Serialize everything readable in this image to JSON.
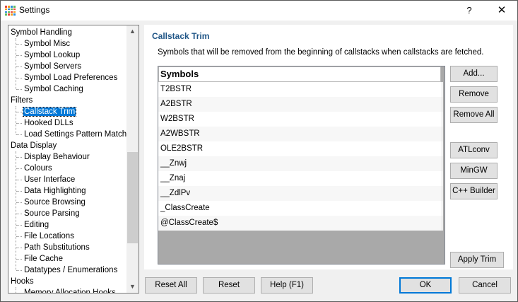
{
  "window": {
    "title": "Settings",
    "help_label": "?",
    "close_label": "✕"
  },
  "tree": {
    "items": [
      {
        "label": "Symbol Handling",
        "level": 0
      },
      {
        "label": "Symbol Misc",
        "level": 1
      },
      {
        "label": "Symbol Lookup",
        "level": 1
      },
      {
        "label": "Symbol Servers",
        "level": 1
      },
      {
        "label": "Symbol Load Preferences",
        "level": 1
      },
      {
        "label": "Symbol Caching",
        "level": 1
      },
      {
        "label": "Filters",
        "level": 0
      },
      {
        "label": "Callstack Trim",
        "level": 1,
        "selected": true
      },
      {
        "label": "Hooked DLLs",
        "level": 1
      },
      {
        "label": "Load Settings Pattern Match",
        "level": 1
      },
      {
        "label": "Data Display",
        "level": 0
      },
      {
        "label": "Display Behaviour",
        "level": 1
      },
      {
        "label": "Colours",
        "level": 1
      },
      {
        "label": "User Interface",
        "level": 1
      },
      {
        "label": "Data Highlighting",
        "level": 1
      },
      {
        "label": "Source Browsing",
        "level": 1
      },
      {
        "label": "Source Parsing",
        "level": 1
      },
      {
        "label": "Editing",
        "level": 1
      },
      {
        "label": "File Locations",
        "level": 1
      },
      {
        "label": "Path Substitutions",
        "level": 1
      },
      {
        "label": "File Cache",
        "level": 1
      },
      {
        "label": "Datatypes / Enumerations",
        "level": 1
      },
      {
        "label": "Hooks",
        "level": 0
      },
      {
        "label": "Memory Allocation Hooks",
        "level": 1
      }
    ],
    "scroll_up_icon": "▲",
    "scroll_down_icon": "▼"
  },
  "panel": {
    "title": "Callstack Trim",
    "description": "Symbols that will be removed from the beginning of callstacks when callstacks are fetched.",
    "list_header": "Symbols",
    "symbols": [
      "T2BSTR",
      "A2BSTR",
      "W2BSTR",
      "A2WBSTR",
      "OLE2BSTR",
      "__Znwj",
      "__Znaj",
      "__ZdlPv",
      "_ClassCreate",
      "@ClassCreate$"
    ],
    "buttons": {
      "add": "Add...",
      "remove": "Remove",
      "remove_all": "Remove All",
      "atlconv": "ATLconv",
      "mingw": "MinGW",
      "cpp_builder": "C++ Builder",
      "apply_trim": "Apply Trim"
    }
  },
  "footer": {
    "reset_all": "Reset All",
    "reset": "Reset",
    "help": "Help (F1)",
    "ok": "OK",
    "cancel": "Cancel"
  },
  "colors": {
    "selection": "#0078d7",
    "panel_title": "#1f5586",
    "default_button_border": "#0078d7"
  },
  "app_icon_colors": [
    "#e8463a",
    "#f29a1e",
    "#2e8bd8",
    "#5cb85c"
  ]
}
